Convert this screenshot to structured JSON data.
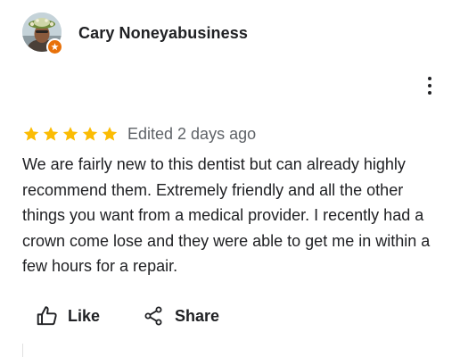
{
  "reviewer": {
    "name": "Cary Noneyabusiness",
    "avatar_icon": "user-avatar-photo",
    "badge_icon": "local-guide-star-icon",
    "badge_color": "#e8710a"
  },
  "more_icon": "more-vert-icon",
  "rating": {
    "stars": 5,
    "max_stars": 5,
    "star_color": "#fbbc04",
    "edited_label": "Edited 2 days ago"
  },
  "review": {
    "text": "We are fairly new to this dentist but can already highly recommend them. Extremely friendly and all the other things you want from a medical provider. I recently had a crown come lose and they were able to get me in within a few hours for a repair."
  },
  "actions": {
    "like_label": "Like",
    "like_icon": "thumb-up-icon",
    "share_label": "Share",
    "share_icon": "share-icon"
  }
}
